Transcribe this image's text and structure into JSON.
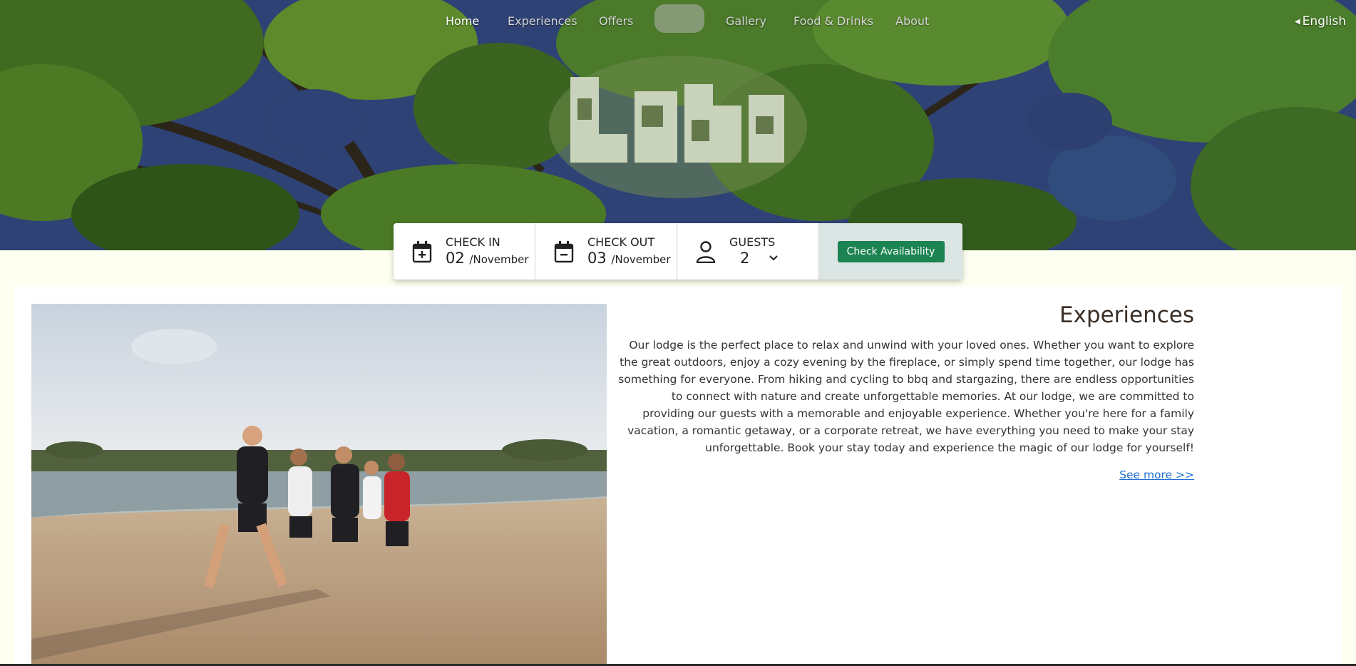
{
  "nav": {
    "items": [
      {
        "label": "Home",
        "active": true
      },
      {
        "label": "Experiences",
        "active": false
      },
      {
        "label": "Offers",
        "active": false
      },
      {
        "label": "Gallery",
        "active": false
      },
      {
        "label": "Food & Drinks",
        "active": false
      },
      {
        "label": "About",
        "active": false
      }
    ],
    "language": "English"
  },
  "booking": {
    "check_in": {
      "label": "CHECK IN",
      "day": "02",
      "month": "/November",
      "icon": "calendar-plus-icon"
    },
    "check_out": {
      "label": "CHECK OUT",
      "day": "03",
      "month": "/November",
      "icon": "calendar-minus-icon"
    },
    "guests": {
      "label": "GUESTS",
      "value": "2",
      "icon": "person-icon"
    },
    "button_label": "Check Availability"
  },
  "experiences": {
    "title": "Experiences",
    "body": "Our lodge is the perfect place to relax and unwind with your loved ones. Whether you want to explore the great outdoors, enjoy a cozy evening by the fireplace, or simply spend time together, our lodge has something for everyone. From hiking and cycling to bbq and stargazing, there are endless opportunities to connect with nature and create unforgettable memories. At our lodge, we are committed to providing our guests with a memorable and enjoyable experience. Whether you're here for a family vacation, a romantic getaway, or a corporate retreat, we have everything you need to make your stay unforgettable. Book your stay today and experience the magic of our lodge for yourself!",
    "link": "See more >>"
  },
  "colors": {
    "page_bg": "#fdfff0",
    "accent_button": "#1c8352",
    "booking_action_bg": "#dbe5e3",
    "link": "#1f6fd1"
  }
}
